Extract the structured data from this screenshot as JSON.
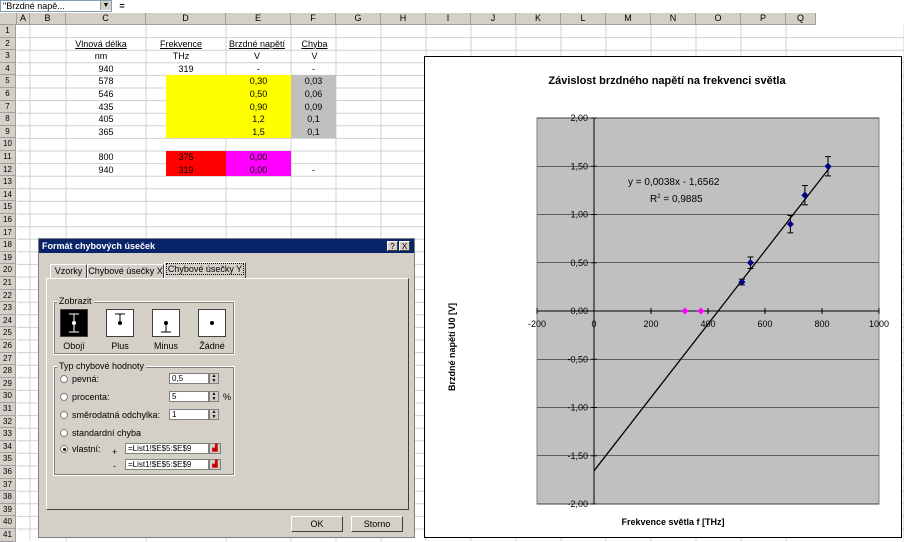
{
  "formula_bar": {
    "name_box": "\"Brzdné napě...",
    "equals": "="
  },
  "columns": [
    "A",
    "B",
    "C",
    "D",
    "E",
    "F",
    "G",
    "H",
    "I",
    "J",
    "K",
    "L",
    "M",
    "N",
    "O",
    "P",
    "Q"
  ],
  "rows": [
    "1",
    "2",
    "3",
    "4",
    "5",
    "6",
    "7",
    "8",
    "9",
    "10",
    "11",
    "12",
    "13",
    "14",
    "15",
    "16",
    "17",
    "18",
    "19",
    "20",
    "21",
    "22",
    "23",
    "24",
    "25",
    "26",
    "27",
    "28",
    "29",
    "30",
    "31",
    "32",
    "33",
    "34",
    "35",
    "36",
    "37",
    "38",
    "39",
    "40",
    "41"
  ],
  "sheet": {
    "headers": [
      "Vlnová délka",
      "Frekvence",
      "Brzdné napětí",
      "Chyba"
    ],
    "units": [
      "nm",
      "THz",
      "V",
      "V"
    ],
    "data_rows": [
      [
        "940",
        "319",
        "-",
        "-"
      ],
      [
        "578",
        "",
        "0,30",
        "0,03"
      ],
      [
        "546",
        "",
        "0,50",
        "0,06"
      ],
      [
        "435",
        "",
        "0,90",
        "0,09"
      ],
      [
        "405",
        "",
        "1,2",
        "0,1"
      ],
      [
        "365",
        "",
        "1,5",
        "0,1"
      ]
    ],
    "extra_rows": [
      [
        "800",
        "375",
        "0,00",
        ""
      ],
      [
        "940",
        "319",
        "0,00",
        "-"
      ]
    ]
  },
  "dialog": {
    "title": "Formát chybových úseček",
    "help_btn": "?",
    "close_btn": "X",
    "tabs": [
      "Vzorky",
      "Chybové úsečky X",
      "Chybové úsečky Y"
    ],
    "display_group": "Zobrazit",
    "display_options": [
      "Obojí",
      "Plus",
      "Minus",
      "Žádné"
    ],
    "type_group": "Typ chybové hodnoty",
    "options": {
      "fixed_label": "pevná:",
      "fixed_value": "0,5",
      "percent_label": "procenta:",
      "percent_value": "5",
      "percent_unit": "%",
      "stdev_label": "směrodatná odchylka:",
      "stdev_value": "1",
      "stderr_label": "standardní chyba",
      "custom_label": "vlastní:",
      "plus_sign": "+",
      "minus_sign": "-",
      "custom_plus": "=List1!$E$5:$E$9",
      "custom_minus": "=List1!$E$5:$E$9"
    },
    "ok": "OK",
    "cancel": "Storno"
  },
  "chart_data": {
    "type": "scatter",
    "title": "Závislost brzdného napětí na frekvenci světla",
    "xlabel": "Frekvence světla  f [THz]",
    "ylabel": "Brzdné napětí  U0 [V]",
    "xlim": [
      -200,
      1000
    ],
    "ylim": [
      -2.0,
      2.0
    ],
    "x_ticks": [
      "-200",
      "0",
      "200",
      "400",
      "600",
      "800",
      "1000"
    ],
    "y_ticks": [
      "2,00",
      "1,50",
      "1,00",
      "0,50",
      "0,00",
      "-0,50",
      "-1,00",
      "-1,50",
      "-2,00"
    ],
    "y_tick_values": [
      2.0,
      1.5,
      1.0,
      0.5,
      0.0,
      -0.5,
      -1.0,
      -1.5,
      -2.0
    ],
    "x_tick_values": [
      -200,
      0,
      200,
      400,
      600,
      800,
      1000
    ],
    "grid": true,
    "series": [
      {
        "color": "#000080",
        "points": [
          [
            519,
            0.3
          ],
          [
            549,
            0.5
          ],
          [
            689,
            0.9
          ],
          [
            740,
            1.2
          ],
          [
            821,
            1.5
          ]
        ],
        "errors": [
          0.03,
          0.06,
          0.09,
          0.1,
          0.1
        ]
      },
      {
        "color": "#ff00ff",
        "points": [
          [
            319,
            0.0
          ],
          [
            375,
            0.0
          ]
        ]
      }
    ],
    "trendline": {
      "slope": 0.0038,
      "intercept": -1.6562,
      "x_range": [
        0,
        830
      ]
    },
    "equation": "y = 0,0038x - 1,6562",
    "r2_prefix": "R",
    "r2_sup": "2",
    "r2_value": " = 0,9885",
    "plot_bg": "#c0c0c0"
  }
}
